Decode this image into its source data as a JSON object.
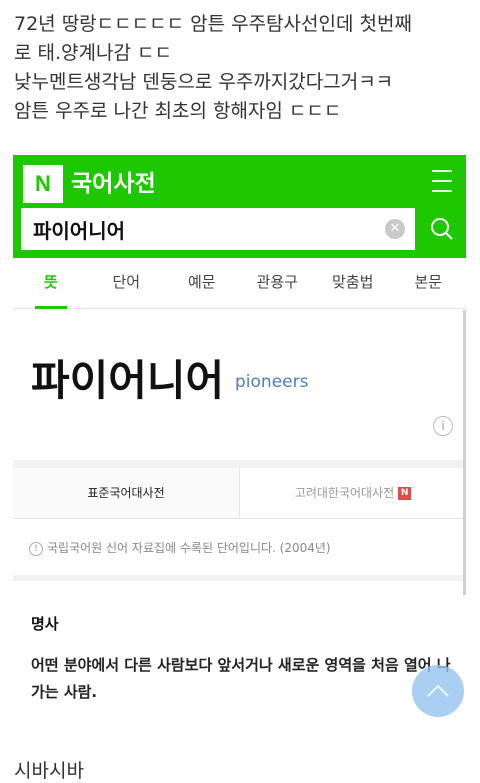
{
  "post": {
    "lines": [
      "72년 땅랑ㄷㄷㄷㄷㄷ 암튼 우주탐사선인데 첫번째",
      "로 태.양계나감 ㄷㄷ",
      "낮누멘트생각남 덴둥으로 우주까지갔다그거ㅋㅋ",
      "암튼 우주로 나간 최초의 항해자임 ㄷㄷㄷ"
    ],
    "caption": "시바시바"
  },
  "app": {
    "logo": "N",
    "title": "국어사전",
    "menu_icon": "hamburger-icon",
    "accent": "#1ec800"
  },
  "search": {
    "value": "파이어니어",
    "clear_icon": "close-icon",
    "search_icon": "search-icon"
  },
  "tabs": [
    "뜻",
    "단어",
    "예문",
    "관용구",
    "맞춤법",
    "본문"
  ],
  "entry": {
    "word": "파이어니어",
    "original": "pioneers",
    "info_icon": "i"
  },
  "dictionaries": {
    "primary": "표준국어대사전",
    "secondary": "고려대한국어대사전",
    "badge": "N"
  },
  "notice": {
    "icon": "!",
    "text": "국립국어원 신어 자료집에 수록된 단어입니다. (2004년)"
  },
  "definition": {
    "pos": "명사",
    "text": "어떤 분야에서 다른 사람보다 앞서거나 새로운 영역을 처음 열어 나가는 사람."
  }
}
